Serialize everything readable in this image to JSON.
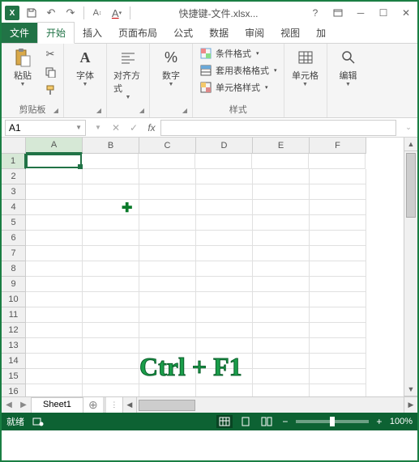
{
  "titlebar": {
    "app_letter": "X",
    "title": "快捷键-文件.xlsx..."
  },
  "tabs": {
    "file": "文件",
    "home": "开始",
    "insert": "插入",
    "layout": "页面布局",
    "formulas": "公式",
    "data": "数据",
    "review": "审阅",
    "view": "视图",
    "addins": "加"
  },
  "ribbon": {
    "clipboard": {
      "paste": "粘贴",
      "label": "剪贴板"
    },
    "font": {
      "btn": "字体",
      "label": ""
    },
    "align": {
      "btn": "对齐方式",
      "label": ""
    },
    "number": {
      "btn": "数字",
      "label": ""
    },
    "styles": {
      "cond": "条件格式",
      "table": "套用表格格式",
      "cell": "单元格样式",
      "label": "样式"
    },
    "cells": {
      "btn": "单元格",
      "label": ""
    },
    "editing": {
      "btn": "编辑",
      "label": ""
    }
  },
  "namebox": {
    "value": "A1"
  },
  "formula": {
    "value": ""
  },
  "columns": [
    "A",
    "B",
    "C",
    "D",
    "E",
    "F"
  ],
  "rows": [
    "1",
    "2",
    "3",
    "4",
    "5",
    "6",
    "7",
    "8",
    "9",
    "10",
    "11",
    "12",
    "13",
    "14",
    "15",
    "16"
  ],
  "active_cell": {
    "row": 0,
    "col": 0
  },
  "overlay": "Ctrl + F1",
  "sheets": {
    "sheet1": "Sheet1"
  },
  "statusbar": {
    "ready": "就绪",
    "zoom": "100%"
  },
  "chart_data": null
}
